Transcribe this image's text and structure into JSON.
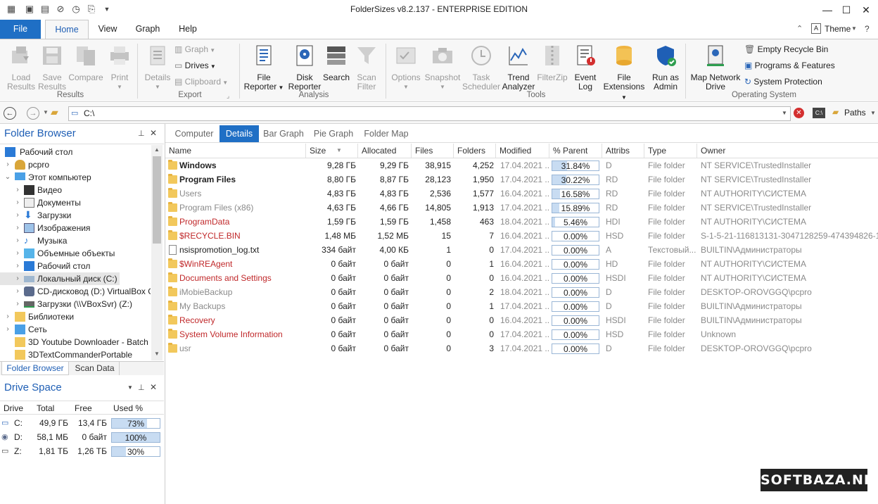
{
  "window": {
    "title": "FolderSizes v8.2.137 - ENTERPRISE EDITION"
  },
  "ribbon_tabs": [
    {
      "label": "File"
    },
    {
      "label": "Home"
    },
    {
      "label": "View"
    },
    {
      "label": "Graph"
    },
    {
      "label": "Help"
    }
  ],
  "theme_label": "Theme",
  "groups": {
    "results": {
      "label": "Results",
      "buttons": [
        {
          "label": "Load\nResults"
        },
        {
          "label": "Save\nResults"
        },
        {
          "label": "Compare"
        },
        {
          "label": "Print"
        }
      ]
    },
    "export": {
      "label": "Export",
      "details": "Details",
      "small": [
        {
          "label": "Graph"
        },
        {
          "label": "Drives"
        },
        {
          "label": "Clipboard"
        }
      ]
    },
    "analysis": {
      "label": "Analysis",
      "buttons": [
        {
          "label": "File\nReporter"
        },
        {
          "label": "Disk\nReporter"
        },
        {
          "label": "Search"
        },
        {
          "label": "Scan\nFilter"
        }
      ]
    },
    "tools": {
      "label": "Tools",
      "buttons": [
        {
          "label": "Options"
        },
        {
          "label": "Snapshot"
        },
        {
          "label": "Task\nScheduler"
        },
        {
          "label": "Trend\nAnalyzer"
        },
        {
          "label": "FilterZip"
        },
        {
          "label": "Event\nLog"
        },
        {
          "label": "File\nExtensions"
        },
        {
          "label": "Run as\nAdmin"
        }
      ]
    },
    "os": {
      "label": "Operating System",
      "map_drive": "Map Network\nDrive",
      "small": [
        {
          "label": "Empty Recycle Bin"
        },
        {
          "label": "Programs & Features"
        },
        {
          "label": "System Protection"
        }
      ]
    }
  },
  "address": {
    "path": "C:\\",
    "paths_label": "Paths"
  },
  "folder_browser": {
    "title": "Folder Browser",
    "items": [
      {
        "label": "Рабочий стол"
      },
      {
        "label": "pcpro"
      },
      {
        "label": "Этот компьютер"
      },
      {
        "label": "Видео"
      },
      {
        "label": "Документы"
      },
      {
        "label": "Загрузки"
      },
      {
        "label": "Изображения"
      },
      {
        "label": "Музыка"
      },
      {
        "label": "Объемные объекты"
      },
      {
        "label": "Рабочий стол"
      },
      {
        "label": "Локальный диск (C:)"
      },
      {
        "label": "CD-дисковод (D:) VirtualBox G"
      },
      {
        "label": "Загрузки (\\\\VBoxSvr) (Z:)"
      },
      {
        "label": "Библиотеки"
      },
      {
        "label": "Сеть"
      },
      {
        "label": "3D Youtube Downloader - Batch"
      },
      {
        "label": "3DTextCommanderPortable"
      }
    ],
    "tabs": [
      {
        "label": "Folder Browser"
      },
      {
        "label": "Scan Data"
      }
    ]
  },
  "drive_space": {
    "title": "Drive Space",
    "headers": [
      "Drive",
      "Total",
      "Free",
      "Used %"
    ],
    "rows": [
      {
        "drive": "C:",
        "total": "49,9 ГБ",
        "free": "13,4 ГБ",
        "used": "73%",
        "used_value": 73
      },
      {
        "drive": "D:",
        "total": "58,1 МБ",
        "free": "0 байт",
        "used": "100%",
        "used_value": 100
      },
      {
        "drive": "Z:",
        "total": "1,81 ТБ",
        "free": "1,26 ТБ",
        "used": "30%",
        "used_value": 30
      }
    ]
  },
  "view_tabs": [
    {
      "label": "Computer"
    },
    {
      "label": "Details"
    },
    {
      "label": "Bar Graph"
    },
    {
      "label": "Pie Graph"
    },
    {
      "label": "Folder Map"
    }
  ],
  "columns": [
    "Name",
    "Size",
    "Allocated",
    "Files",
    "Folders",
    "Modified",
    "% Parent",
    "Attribs",
    "Type",
    "Owner"
  ],
  "rows": [
    {
      "name": "Windows",
      "size": "9,28 ГБ",
      "alloc": "9,29 ГБ",
      "files": "38,915",
      "folders": "4,252",
      "modified": "17.04.2021 ...",
      "pct": "31.84%",
      "pct_value": 31.84,
      "attr": "D",
      "type": "File folder",
      "owner": "NT SERVICE\\TrustedInstaller"
    },
    {
      "name": "Program Files",
      "size": "8,80 ГБ",
      "alloc": "8,87 ГБ",
      "files": "28,123",
      "folders": "1,950",
      "modified": "17.04.2021 ...",
      "pct": "30.22%",
      "pct_value": 30.22,
      "attr": "RD",
      "type": "File folder",
      "owner": "NT SERVICE\\TrustedInstaller"
    },
    {
      "name": "Users",
      "size": "4,83 ГБ",
      "alloc": "4,83 ГБ",
      "files": "2,536",
      "folders": "1,577",
      "modified": "16.04.2021 ...",
      "pct": "16.58%",
      "pct_value": 16.58,
      "attr": "RD",
      "type": "File folder",
      "owner": "NT AUTHORITY\\СИСТЕМА"
    },
    {
      "name": "Program Files (x86)",
      "size": "4,63 ГБ",
      "alloc": "4,66 ГБ",
      "files": "14,805",
      "folders": "1,913",
      "modified": "17.04.2021 ...",
      "pct": "15.89%",
      "pct_value": 15.89,
      "attr": "RD",
      "type": "File folder",
      "owner": "NT SERVICE\\TrustedInstaller"
    },
    {
      "name": "ProgramData",
      "size": "1,59 ГБ",
      "alloc": "1,59 ГБ",
      "files": "1,458",
      "folders": "463",
      "modified": "18.04.2021 ...",
      "pct": "5.46%",
      "pct_value": 5.46,
      "attr": "HDI",
      "type": "File folder",
      "owner": "NT AUTHORITY\\СИСТЕМА"
    },
    {
      "name": "$RECYCLE.BIN",
      "size": "1,48 МБ",
      "alloc": "1,52 МБ",
      "files": "15",
      "folders": "7",
      "modified": "16.04.2021 ...",
      "pct": "0.00%",
      "pct_value": 0,
      "attr": "HSD",
      "type": "File folder",
      "owner": "S-1-5-21-116813131-3047128259-474394826-1..."
    },
    {
      "name": "nsispromotion_log.txt",
      "size": "334 байт",
      "alloc": "4,00 КБ",
      "files": "1",
      "folders": "0",
      "modified": "17.04.2021 ...",
      "pct": "0.00%",
      "pct_value": 0,
      "attr": "A",
      "type": "Текстовый...",
      "owner": "BUILTIN\\Администраторы"
    },
    {
      "name": "$WinREAgent",
      "size": "0 байт",
      "alloc": "0 байт",
      "files": "0",
      "folders": "1",
      "modified": "16.04.2021 ...",
      "pct": "0.00%",
      "pct_value": 0,
      "attr": "HD",
      "type": "File folder",
      "owner": "NT AUTHORITY\\СИСТЕМА"
    },
    {
      "name": "Documents and Settings",
      "size": "0 байт",
      "alloc": "0 байт",
      "files": "0",
      "folders": "0",
      "modified": "16.04.2021 ...",
      "pct": "0.00%",
      "pct_value": 0,
      "attr": "HSDI",
      "type": "File folder",
      "owner": "NT AUTHORITY\\СИСТЕМА"
    },
    {
      "name": "iMobieBackup",
      "size": "0 байт",
      "alloc": "0 байт",
      "files": "0",
      "folders": "2",
      "modified": "18.04.2021 ...",
      "pct": "0.00%",
      "pct_value": 0,
      "attr": "D",
      "type": "File folder",
      "owner": "DESKTOP-OROVGGQ\\pcpro"
    },
    {
      "name": "My Backups",
      "size": "0 байт",
      "alloc": "0 байт",
      "files": "0",
      "folders": "1",
      "modified": "17.04.2021 ...",
      "pct": "0.00%",
      "pct_value": 0,
      "attr": "D",
      "type": "File folder",
      "owner": "BUILTIN\\Администраторы"
    },
    {
      "name": "Recovery",
      "size": "0 байт",
      "alloc": "0 байт",
      "files": "0",
      "folders": "0",
      "modified": "16.04.2021 ...",
      "pct": "0.00%",
      "pct_value": 0,
      "attr": "HSDI",
      "type": "File folder",
      "owner": "BUILTIN\\Администраторы"
    },
    {
      "name": "System Volume Information",
      "size": "0 байт",
      "alloc": "0 байт",
      "files": "0",
      "folders": "0",
      "modified": "17.04.2021 ...",
      "pct": "0.00%",
      "pct_value": 0,
      "attr": "HSD",
      "type": "File folder",
      "owner": "Unknown"
    },
    {
      "name": "usr",
      "size": "0 байт",
      "alloc": "0 байт",
      "files": "0",
      "folders": "3",
      "modified": "17.04.2021 ...",
      "pct": "0.00%",
      "pct_value": 0,
      "attr": "D",
      "type": "File folder",
      "owner": "DESKTOP-OROVGGQ\\pcpro"
    }
  ],
  "watermark": "SOFTBAZA.NET"
}
